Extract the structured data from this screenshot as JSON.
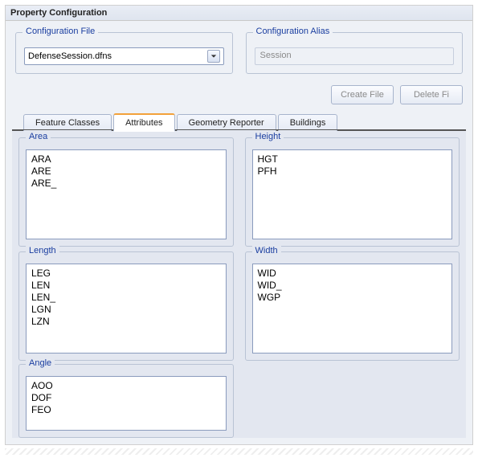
{
  "header": {
    "title": "Property Configuration"
  },
  "config_file": {
    "label": "Configuration File",
    "value": "DefenseSession.dfns"
  },
  "config_alias": {
    "label": "Configuration Alias",
    "value": "Session"
  },
  "buttons": {
    "create": "Create File",
    "delete": "Delete Fi"
  },
  "tabs": {
    "feature_classes": "Feature Classes",
    "attributes": "Attributes",
    "geometry_reporter": "Geometry Reporter",
    "buildings": "Buildings",
    "active": "attributes"
  },
  "groups": {
    "area": {
      "label": "Area",
      "items": [
        "ARA",
        "ARE",
        "ARE_"
      ]
    },
    "height": {
      "label": "Height",
      "items": [
        "HGT",
        "PFH"
      ]
    },
    "length": {
      "label": "Length",
      "items": [
        "LEG",
        "LEN",
        "LEN_",
        "LGN",
        "LZN"
      ]
    },
    "width": {
      "label": "Width",
      "items": [
        "WID",
        "WID_",
        "WGP"
      ]
    },
    "angle": {
      "label": "Angle",
      "items": [
        "AOO",
        "DOF",
        "FEO"
      ]
    }
  }
}
